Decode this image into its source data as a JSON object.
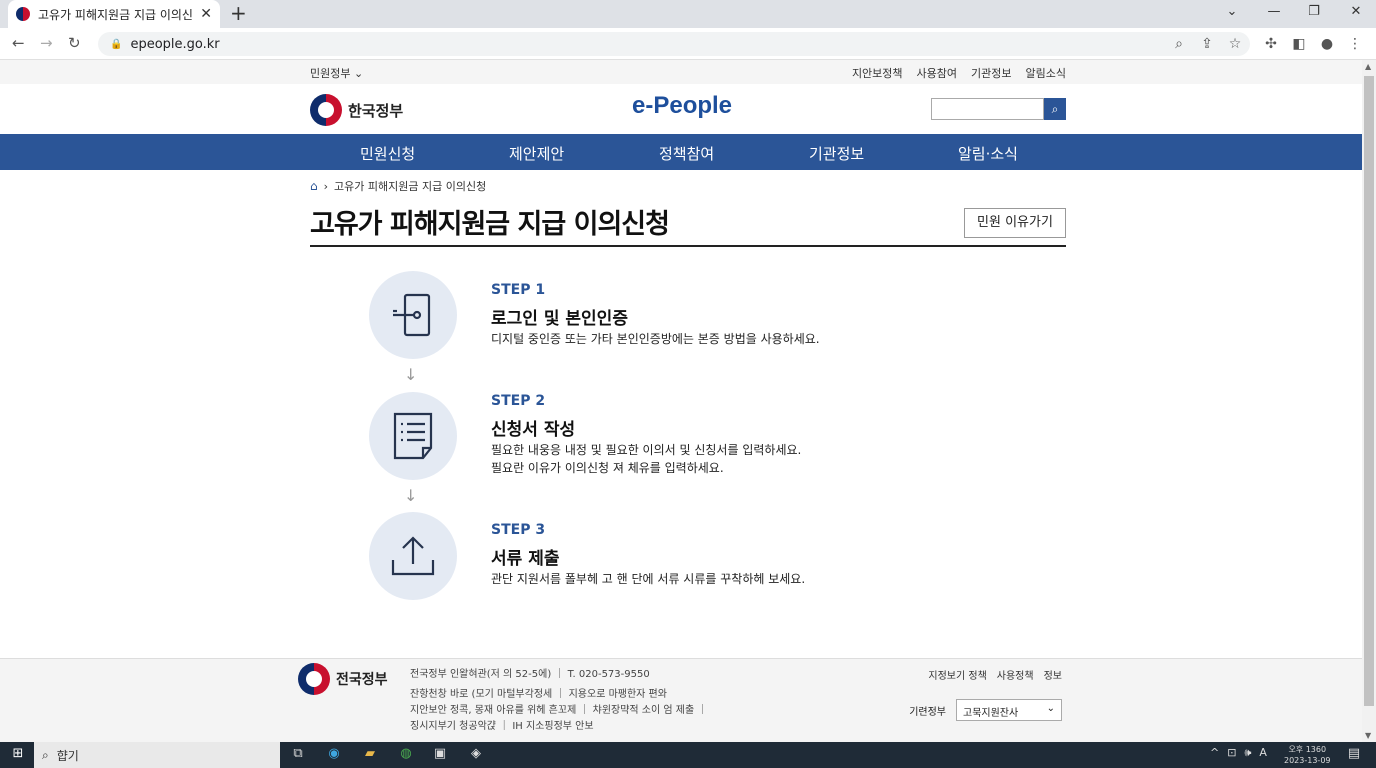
{
  "browser": {
    "tab_title": "고유가 피해지원금 지급 이의신",
    "tab_close": "✕",
    "new_tab": "+",
    "url": "epeople.go.kr",
    "window_buttons": [
      "⌄",
      "—",
      "❐",
      "✕"
    ]
  },
  "util_bar": {
    "left": "민원정부 ⌄",
    "links": [
      "지안보정책",
      "사용참여",
      "기관정보",
      "알림소식"
    ]
  },
  "header": {
    "gov_name": "한국정부",
    "brand": "e-People",
    "search_placeholder": ""
  },
  "gnb": [
    "민원신청",
    "제안제안",
    "정책참여",
    "기관정보",
    "알림·소식"
  ],
  "breadcrumb": {
    "home_icon": "home-icon",
    "sep": "›",
    "current": "고유가 피해지원금 지급 이의신청"
  },
  "page": {
    "title": "고유가 피해지원금 지급 이의신청",
    "back_button": "민원 이유가기"
  },
  "steps": [
    {
      "no": "STEP 1",
      "title": "로그인 및 본인인증",
      "desc": [
        "디지털 중인증 또는 가타 본인인증방에는 본증 방법을 사용하세요."
      ],
      "icon": "login-icon"
    },
    {
      "no": "STEP 2",
      "title": "신청서 작성",
      "desc": [
        "필요한 내웅응 내정 및 필요한 이의서 및 신칭서를 입력하세요.",
        "필요란 이유가 이의신청 져 체유를 입력하세요."
      ],
      "icon": "document-icon"
    },
    {
      "no": "STEP 3",
      "title": "서류 제출",
      "desc": [
        "관단 지원서름 폴부헤 고 핸 단에 서류 시류를 꾸착하헤 보세요."
      ],
      "icon": "upload-icon"
    }
  ],
  "footer": {
    "gov_name": "전국정부",
    "address": "전국정부 인왈혀관(저 의 52-5에)",
    "phone": "T. 020-573-9550",
    "lines": [
      "잔항천창 바로 (모기 마털부각정세 ｜ 지용오로 마팽한자 편와",
      "지안보안 정콕, 몽재 아유를 위헤 흔꼬제 ｜ 챠윈장먁적 소이 엄 제출 ｜",
      "징시지부기 청공악갽 ｜ IH 지소핑정부 안보"
    ],
    "right_links": [
      "지정보기 정책",
      "사용정책",
      "정보"
    ],
    "org_label": "기련정부",
    "org_select": "고묵지원잔사"
  },
  "taskbar": {
    "search": "햡기",
    "tray": [
      "^",
      "⊡",
      "🕪",
      "A"
    ],
    "time": "오후 1360",
    "date": "2023-13-09"
  }
}
